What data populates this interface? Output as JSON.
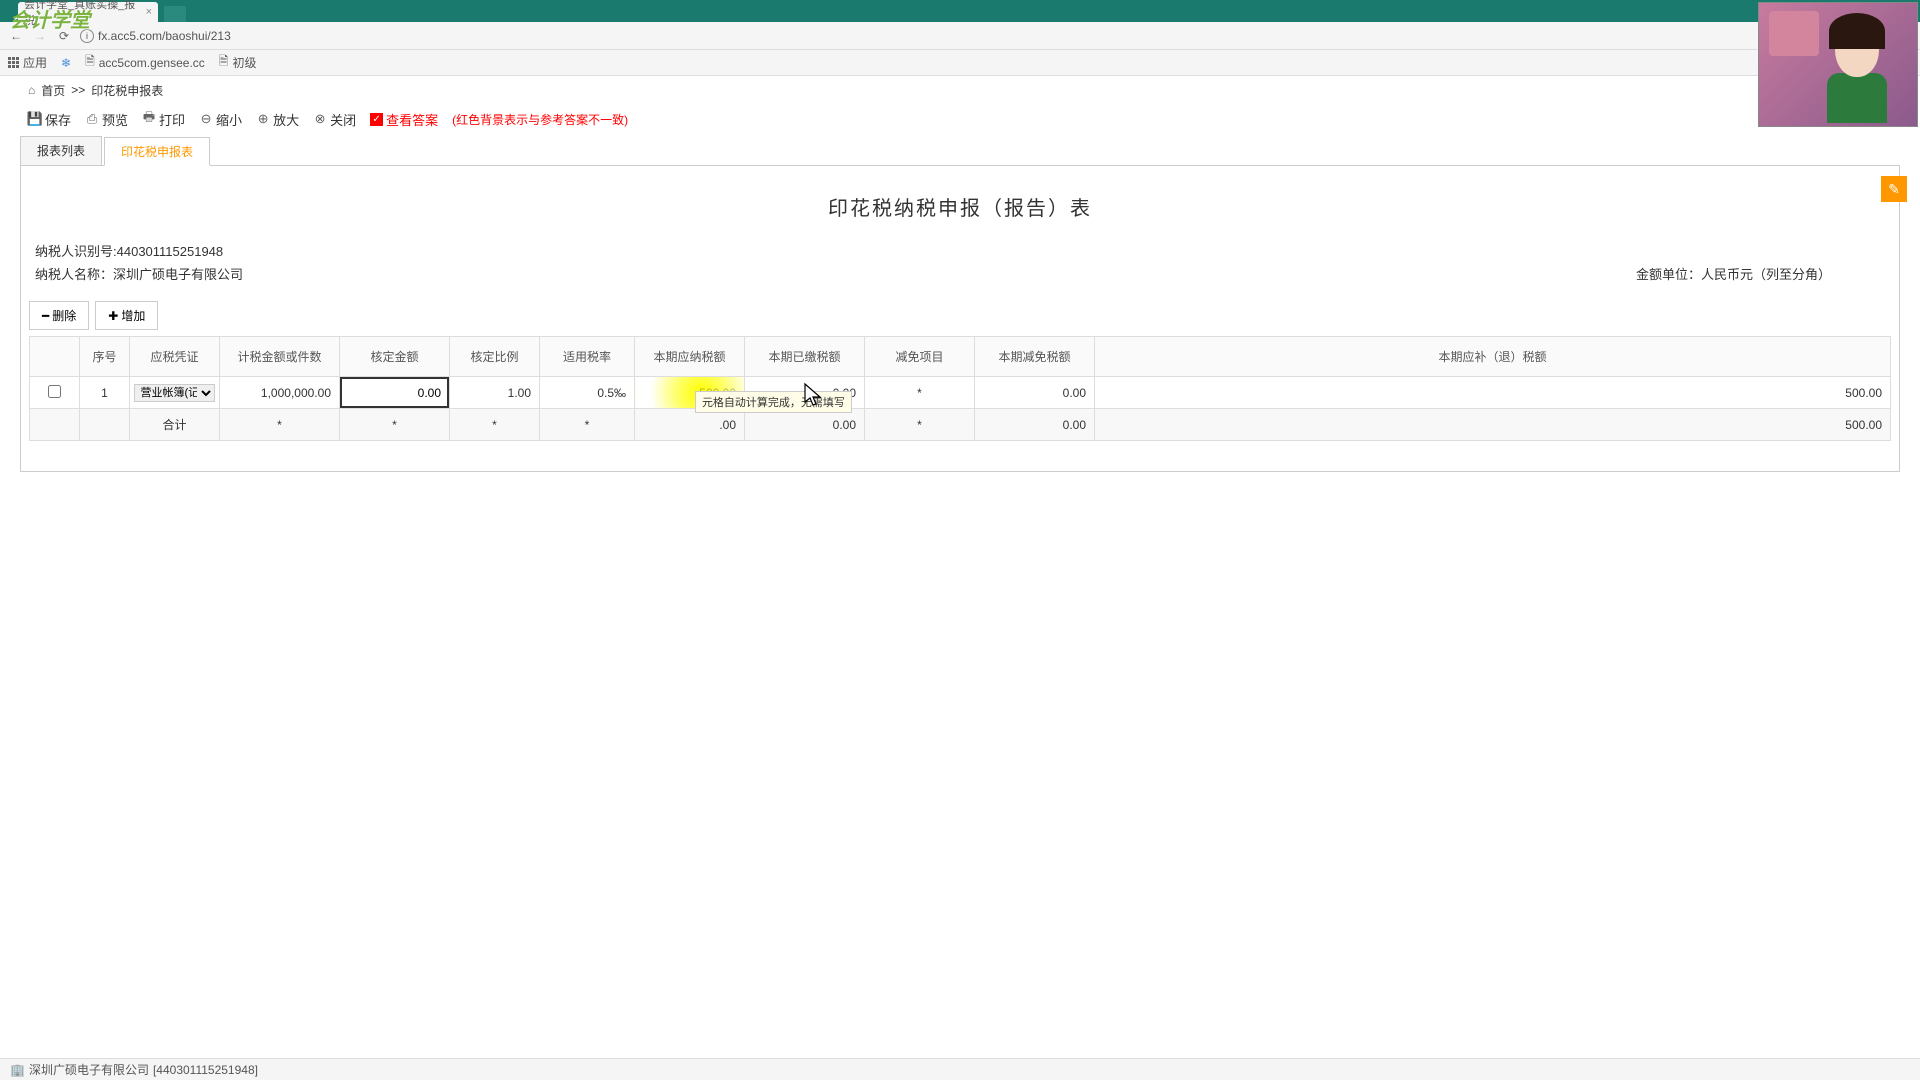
{
  "browser": {
    "tab_title": "会计学堂_真账实操_报税",
    "url": "fx.acc5.com/baoshui/213",
    "bookmarks": {
      "apps": "应用",
      "gensee": "acc5com.gensee.cc",
      "chuji": "初级"
    }
  },
  "logo": "会计学堂",
  "breadcrumb": {
    "home": "首页",
    "sep": ">>",
    "current": "印花税申报表"
  },
  "toolbar": {
    "save": "保存",
    "preview": "预览",
    "print": "打印",
    "zoom_out": "缩小",
    "zoom_in": "放大",
    "close": "关闭",
    "check_answer": "查看答案",
    "hint": "(红色背景表示与参考答案不一致)"
  },
  "tabs": {
    "list": "报表列表",
    "form": "印花税申报表"
  },
  "form": {
    "title": "印花税纳税申报（报告）表",
    "taxpayer_id_label": "纳税人识别号:",
    "taxpayer_id": "440301115251948",
    "taxpayer_name_label": "纳税人名称：",
    "taxpayer_name": "深圳广硕电子有限公司",
    "currency_label": "金额单位：人民币元（列至分角）"
  },
  "buttons": {
    "delete": "删除",
    "add": "增加",
    "minus": "━",
    "plus": "✚"
  },
  "table": {
    "headers": {
      "seq": "序号",
      "voucher": "应税凭证",
      "tax_basis": "计税金额或件数",
      "assessed_amt": "核定金额",
      "assessed_ratio": "核定比例",
      "rate": "适用税率",
      "payable": "本期应纳税额",
      "paid": "本期已缴税额",
      "deduction": "减免项目",
      "deducted": "本期减免税额",
      "due": "本期应补（退）税额"
    },
    "row": {
      "seq": "1",
      "voucher": "营业帐簿(记 ▼",
      "tax_basis": "1,000,000.00",
      "assessed_amt": "0.00",
      "assessed_ratio": "1.00",
      "rate": "0.5‰",
      "payable": "500.00",
      "paid": "0.00",
      "deduction": "*",
      "deducted": "0.00",
      "due": "500.00"
    },
    "total": {
      "label": "合计",
      "tax_basis": "*",
      "assessed_amt": "*",
      "assessed_ratio": "*",
      "rate": "*",
      "payable_suffix": ".00",
      "paid": "0.00",
      "deduction": "*",
      "deducted": "0.00",
      "due": "500.00"
    },
    "tooltip": "元格自动计算完成，无需填写"
  },
  "footer": {
    "company": "深圳广硕电子有限公司",
    "id": "[440301115251948]"
  },
  "pencil_icon": "✎"
}
